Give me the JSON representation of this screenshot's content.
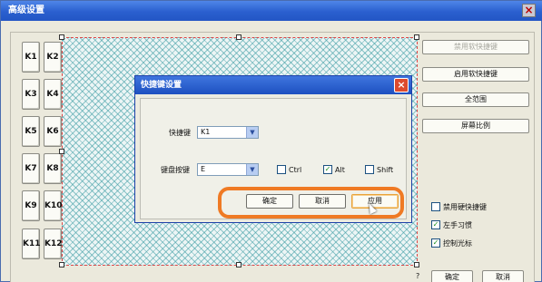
{
  "window": {
    "title": "高级设置",
    "close_label": "×"
  },
  "key_buttons": [
    "K1",
    "K2",
    "K3",
    "K4",
    "K5",
    "K6",
    "K7",
    "K8",
    "K9",
    "K10",
    "K11",
    "K12"
  ],
  "right_buttons": {
    "disable_shortcut": "禁用软快捷键",
    "enable_shortcut": "启用软快捷键",
    "full_range": "全范围",
    "screen_ratio": "屏幕比例"
  },
  "checkboxes": {
    "disable_hw_shortcut": {
      "label": "禁用硬快捷键",
      "checked": false
    },
    "left_hand": {
      "label": "左手习惯",
      "checked": true
    },
    "control_cursor": {
      "label": "控制光标",
      "checked": true
    }
  },
  "bottom": {
    "help": "?",
    "ok": "确定",
    "cancel": "取消"
  },
  "dialog": {
    "title": "快捷键设置",
    "close_label": "×",
    "shortcut_label": "快捷键",
    "shortcut_value": "K1",
    "keyboard_label": "键盘按键",
    "keyboard_value": "E",
    "modifiers": {
      "ctrl": {
        "label": "Ctrl",
        "checked": false
      },
      "alt": {
        "label": "Alt",
        "checked": true
      },
      "shift": {
        "label": "Shift",
        "checked": false
      }
    },
    "buttons": {
      "ok": "确定",
      "cancel": "取消",
      "apply": "应用"
    }
  },
  "icons": {
    "dropdown": "chevron-down-icon",
    "check": "checkmark-icon"
  },
  "colors": {
    "title_bar": "#2a5fcf",
    "highlight": "#ef7a24",
    "hatch": "#3a9ba2"
  }
}
